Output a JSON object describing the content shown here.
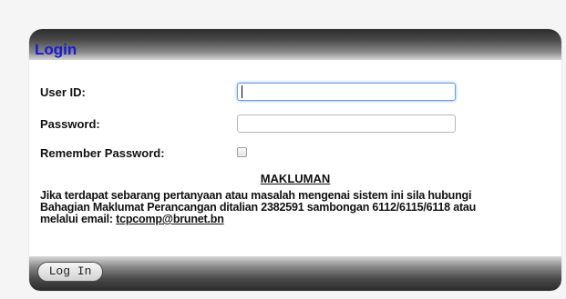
{
  "header": {
    "title": "Login"
  },
  "form": {
    "user_id_label": "User ID:",
    "user_id_value": "",
    "password_label": "Password:",
    "password_value": "",
    "remember_label": "Remember Password:",
    "remember_checked": false
  },
  "notice": {
    "title": "MAKLUMAN",
    "text_line1": "Jika terdapat sebarang pertanyaan atau masalah mengenai sistem ini sila hubungi",
    "text_line2": "Bahagian Maklumat Perancangan ditalian 2382591 sambongan 6112/6115/6118 atau",
    "text_line3_prefix": "melalui email: ",
    "email": "tcpcomp@brunet.bn"
  },
  "footer": {
    "login_button_label": "Log In"
  }
}
